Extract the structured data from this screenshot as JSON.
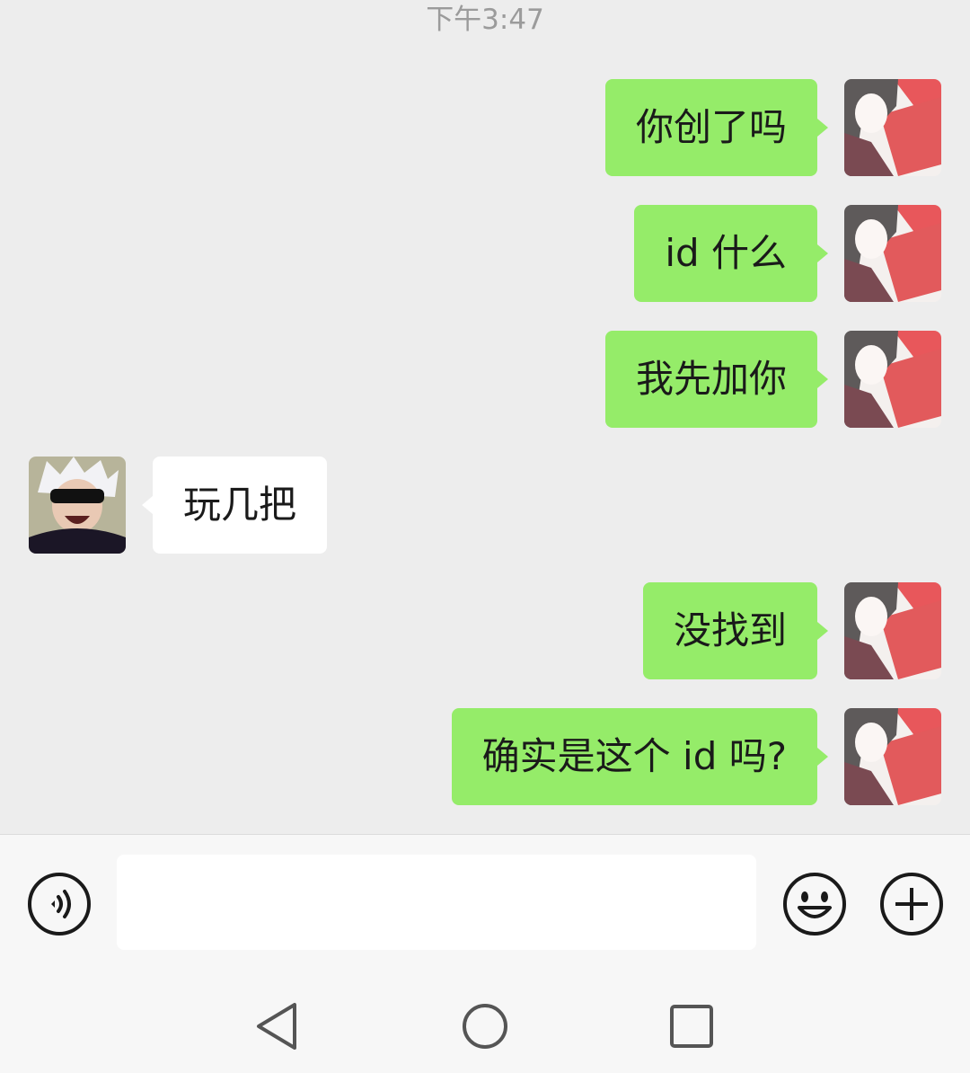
{
  "timestamp": "下午3:47",
  "messages": [
    {
      "side": "me",
      "text": "你创了吗"
    },
    {
      "side": "me",
      "text": "id 什么"
    },
    {
      "side": "me",
      "text": "我先加你"
    },
    {
      "side": "them",
      "text": "玩几把"
    },
    {
      "side": "me",
      "text": "没找到"
    },
    {
      "side": "me",
      "text": "确实是这个 id 吗?"
    }
  ],
  "input": {
    "value": "",
    "placeholder": ""
  },
  "icons": {
    "voice": "voice-icon",
    "emoji": "emoji-icon",
    "plus": "plus-icon",
    "back": "nav-back-icon",
    "home": "nav-home-icon",
    "recents": "nav-recents-icon"
  },
  "colors": {
    "sent_bubble": "#95ec69",
    "received_bubble": "#ffffff",
    "chat_background": "#ededed"
  }
}
